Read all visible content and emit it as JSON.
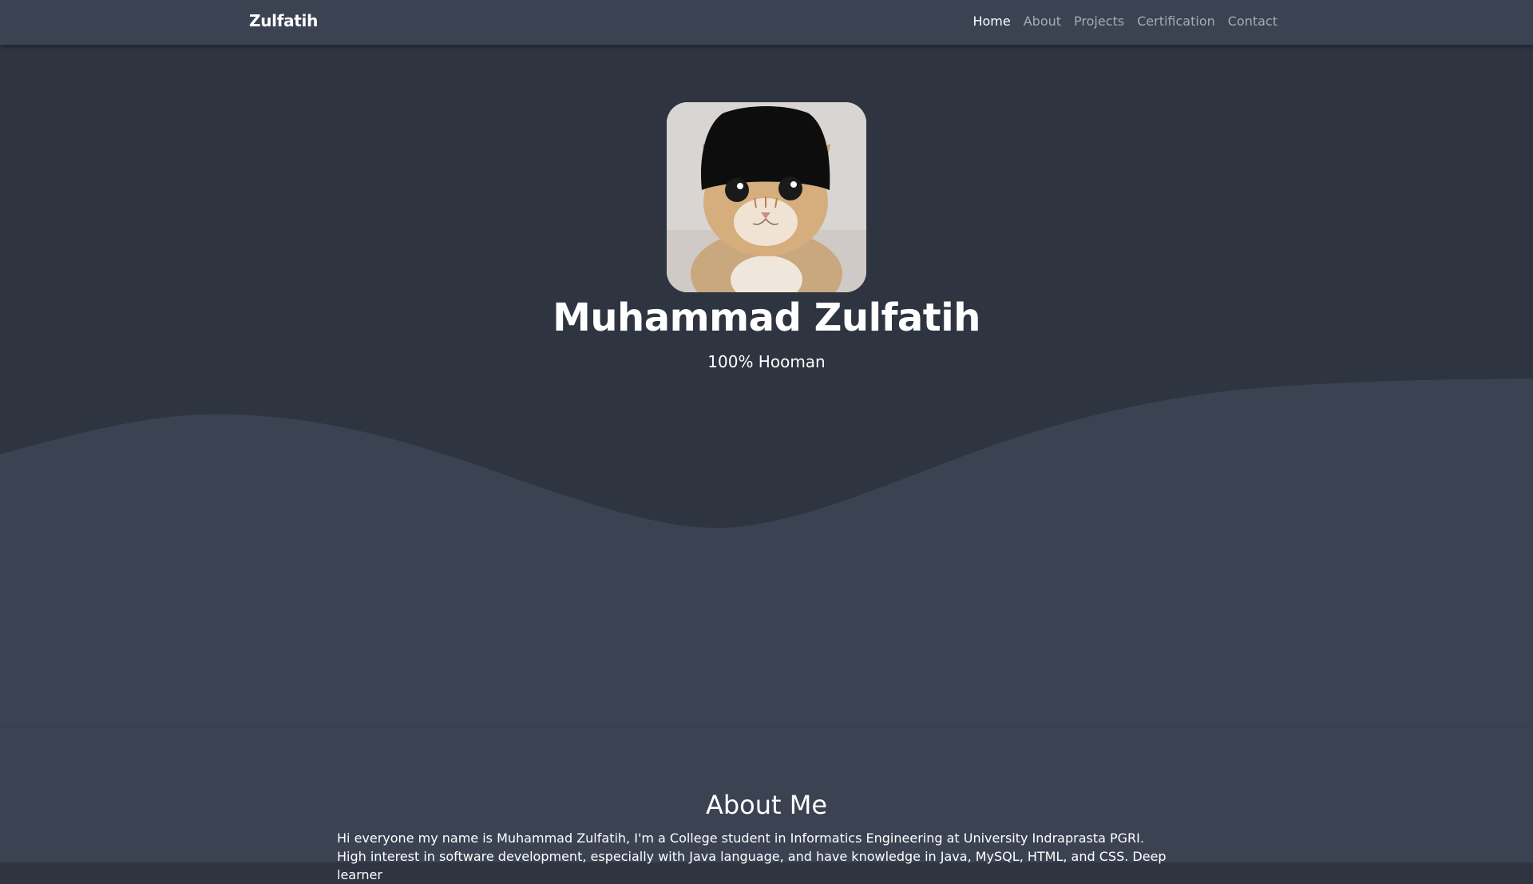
{
  "navbar": {
    "brand": "Zulfatih",
    "links": [
      {
        "label": "Home",
        "active": true
      },
      {
        "label": "About",
        "active": false
      },
      {
        "label": "Projects",
        "active": false
      },
      {
        "label": "Certification",
        "active": false
      },
      {
        "label": "Contact",
        "active": false
      }
    ]
  },
  "hero": {
    "name": "Muhammad Zulfatih",
    "tagline": "100% Hooman",
    "avatar_icon": "cat-with-hat-photo"
  },
  "about": {
    "title": "About Me",
    "text": "Hi everyone my name is Muhammad Zulfatih, I'm a College student in Informatics Engineering at University Indraprasta PGRI. High interest in software development, especially with Java language, and have knowledge in Java, MySQL, HTML, and CSS. Deep learner"
  },
  "colors": {
    "navbar_bg": "#3b4252",
    "hero_bg": "#2e3440",
    "wave": "#3b4252",
    "text": "#ffffff",
    "nav_inactive": "#9fa3ab"
  }
}
